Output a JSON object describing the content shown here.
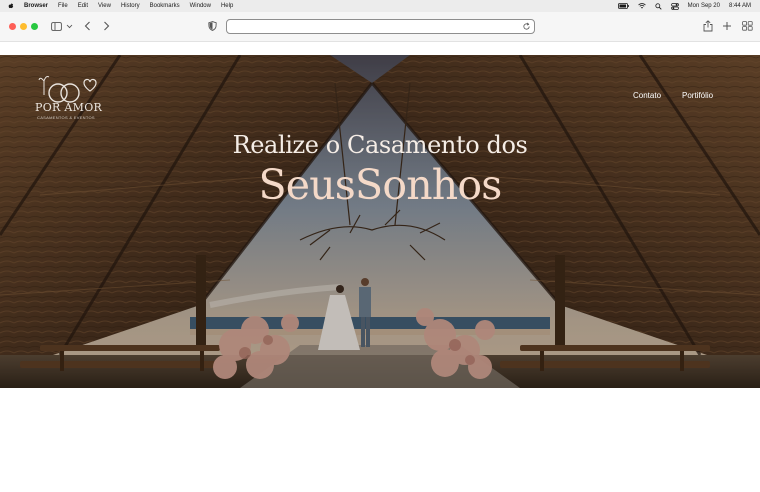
{
  "menubar": {
    "app": "Browser",
    "items": [
      "File",
      "Edit",
      "View",
      "History",
      "Bookmarks",
      "Window",
      "Help"
    ],
    "date": "Mon Sep 20",
    "time": "8:44 AM"
  },
  "toolbar": {
    "address_value": "",
    "icons": [
      "sidebar-icon",
      "chevron-down-icon",
      "back-icon",
      "forward-icon",
      "shield-icon",
      "reload-icon",
      "share-icon",
      "new-tab-icon",
      "tab-overview-icon"
    ]
  },
  "site": {
    "logo_text": "POR AMOR",
    "logo_subtext": "CASAMENTOS & EVENTOS",
    "nav": {
      "contato": "Contato",
      "portfolio": "Portifólio"
    },
    "hero": {
      "headline": "Realize o Casamento dos",
      "headline_emphasis": "SeusSonhos"
    }
  },
  "colors": {
    "headline": "#f5ede6",
    "headline_emphasis": "#f4d9c8",
    "thatch": "#5a3a22",
    "sky": "#9fb4c6"
  }
}
